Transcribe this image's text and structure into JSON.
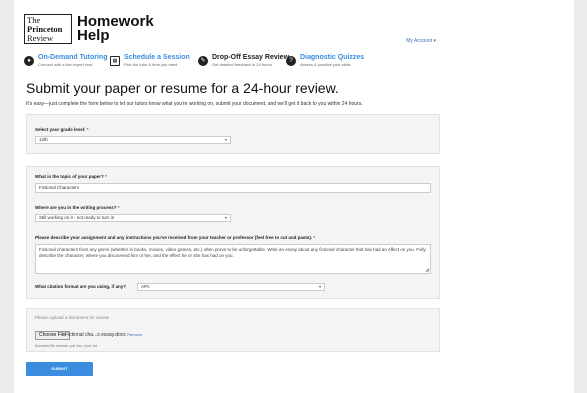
{
  "brand": {
    "logo_line1": "The",
    "logo_line2": "Princeton",
    "logo_line3": "Review",
    "product_line1": "Homework",
    "product_line2": "Help"
  },
  "header": {
    "account_label": "My Account",
    "account_caret": "▾"
  },
  "services": [
    {
      "icon": "chat-icon",
      "glyph": "●",
      "title": "On-Demand Tutoring",
      "subtitle": "Connect with a live expert now",
      "color": "#3b8de0"
    },
    {
      "icon": "calendar-icon",
      "glyph": "▦",
      "title": "Schedule a Session",
      "subtitle": "Pick the tutor & time you need",
      "color": "#3b8de0"
    },
    {
      "icon": "essay-icon",
      "glyph": "✎",
      "title": "Drop-Off Essay Review",
      "subtitle": "Get detailed feedback in 24 hours",
      "color": "#222222"
    },
    {
      "icon": "quiz-icon",
      "glyph": "?",
      "title": "Diagnostic Quizzes",
      "subtitle": "Assess & practice your skills",
      "color": "#3b8de0"
    }
  ],
  "main": {
    "title": "Submit your paper or resume for a 24-hour review.",
    "intro": "It's easy—just complete the form below to let our tutors know what you're working on, submit your document, and we'll get it back to you within 24 hours."
  },
  "form": {
    "grade": {
      "label": "Select your grade level:",
      "required": " *",
      "value": "12th",
      "arrow": "▾"
    },
    "topic": {
      "label": "What is the topic of your paper?",
      "required": " *",
      "value": "Fictional Characters"
    },
    "stage": {
      "label": "Where are you in the writing process?",
      "required": " *",
      "value": "Still working on it - not ready to turn in",
      "arrow": "▾"
    },
    "description": {
      "label": "Please describe your assignment and any instructions you've received from your teacher or professor (feel free to cut and paste).",
      "required": " *",
      "value": "Fictional characters from any genre (whether in books, movies, video games, etc.) often prove to be unforgettable. Write an essay about any fictional character that has had an effect on you. Fully describe the character, where you discovered him or her, and the effect he or she has had on you.",
      "grip": "◢"
    },
    "citation": {
      "label": "What citation format are you using, if any?",
      "value": "APA",
      "arrow": "▾"
    },
    "upload": {
      "label": "Please upload a document for review",
      "button": "Choose File",
      "file_name": "Fictional cha...s essay.docx",
      "remove": "Remove",
      "accepted": "Accepted file formats: pdf, doc, docx, txt"
    },
    "submit": "SUBMIT"
  }
}
